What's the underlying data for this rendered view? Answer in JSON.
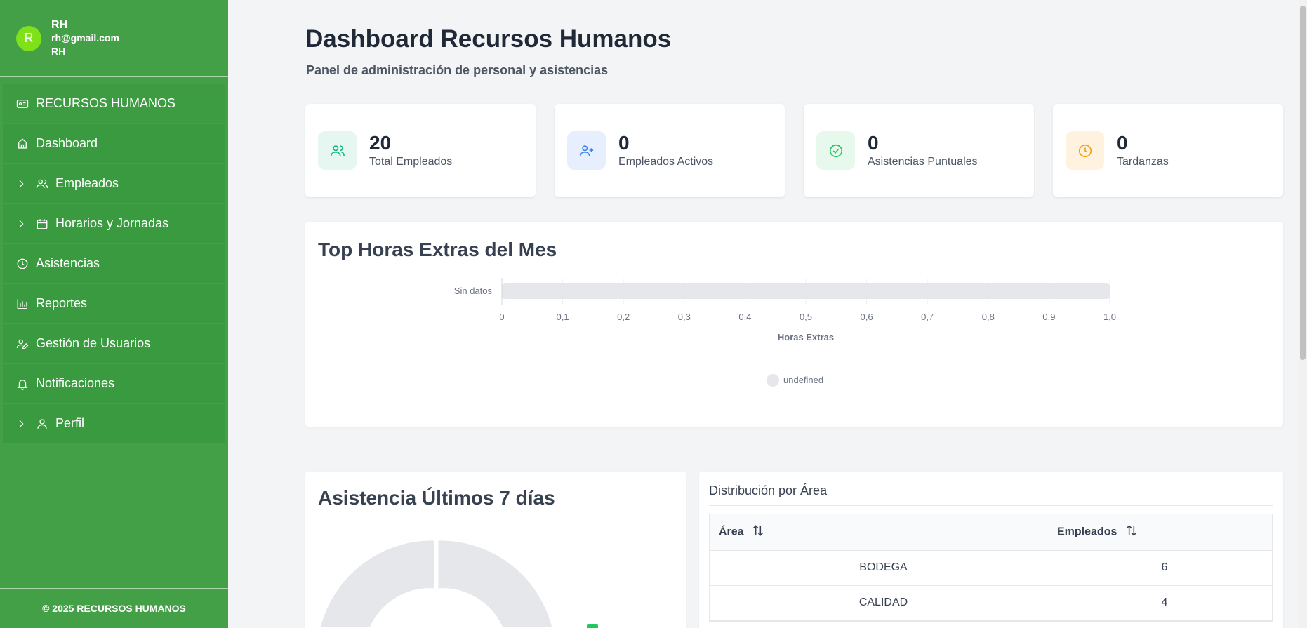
{
  "user": {
    "initial": "R",
    "name": "RH",
    "email": "rh@gmail.com",
    "role": "RH"
  },
  "sidebar": {
    "header": "RECURSOS HUMANOS",
    "items": [
      {
        "label": "Dashboard",
        "icon": "home-icon"
      },
      {
        "label": "Empleados",
        "icon": "users-icon"
      },
      {
        "label": "Horarios y Jornadas",
        "icon": "calendar-icon"
      },
      {
        "label": "Asistencias",
        "icon": "clock-icon"
      },
      {
        "label": "Reportes",
        "icon": "bar-chart-icon"
      },
      {
        "label": "Gestión de Usuarios",
        "icon": "user-edit-icon"
      },
      {
        "label": "Notificaciones",
        "icon": "bell-icon"
      },
      {
        "label": "Perfil",
        "icon": "user-icon"
      }
    ],
    "footer": "© 2025 RECURSOS HUMANOS"
  },
  "page": {
    "title": "Dashboard Recursos Humanos",
    "subtitle": "Panel de administración de personal y asistencias"
  },
  "stats": [
    {
      "value": "20",
      "label": "Total Empleados",
      "color": "#10b981",
      "bg": "#e6f7f1"
    },
    {
      "value": "0",
      "label": "Empleados Activos",
      "color": "#3b82f6",
      "bg": "#e7efff"
    },
    {
      "value": "0",
      "label": "Asistencias Puntuales",
      "color": "#22c55e",
      "bg": "#e7f8ec"
    },
    {
      "value": "0",
      "label": "Tardanzas",
      "color": "#f59e0b",
      "bg": "#fff3e0"
    }
  ],
  "overtime_card": {
    "title": "Top Horas Extras del Mes"
  },
  "chart_data": {
    "type": "bar",
    "orientation": "horizontal",
    "categories": [
      "Sin datos"
    ],
    "series": [
      {
        "name": "undefined",
        "values": [
          0
        ]
      }
    ],
    "xlabel": "Horas Extras",
    "ylabel": "",
    "xlim": [
      0,
      1.0
    ],
    "xticks": [
      "0",
      "0,1",
      "0,2",
      "0,3",
      "0,4",
      "0,5",
      "0,6",
      "0,7",
      "0,8",
      "0,9",
      "1,0"
    ],
    "grid": true,
    "legend": "bottom",
    "bar_color": "#e5e7eb"
  },
  "attendance_card": {
    "title": "Asistencia Últimos 7 días"
  },
  "area_table": {
    "title": "Distribución por Área",
    "columns": [
      "Área",
      "Empleados"
    ],
    "rows": [
      {
        "area": "BODEGA",
        "count": "6"
      },
      {
        "area": "CALIDAD",
        "count": "4"
      }
    ]
  }
}
